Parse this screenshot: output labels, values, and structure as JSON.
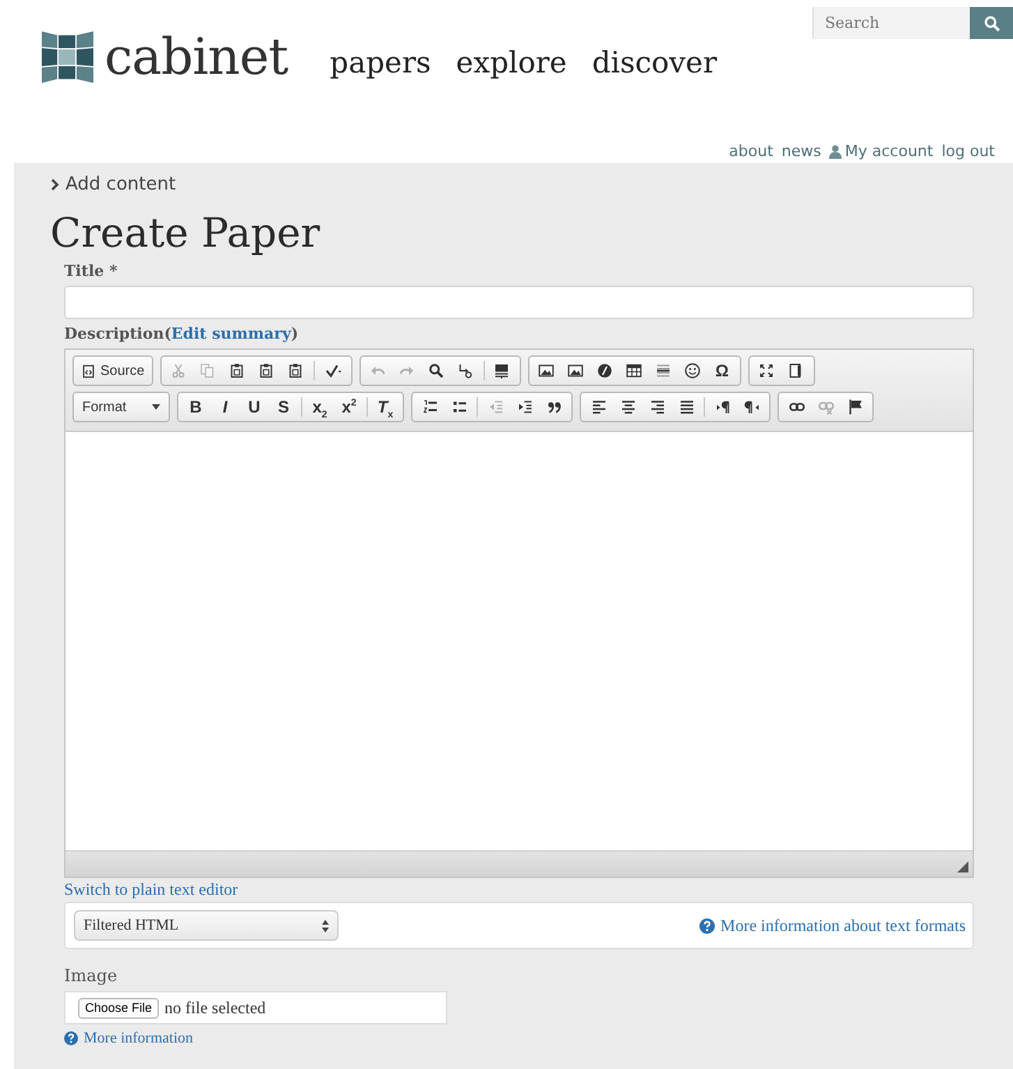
{
  "header": {
    "logo_text": "cabinet",
    "nav": [
      {
        "label": "papers"
      },
      {
        "label": "explore"
      },
      {
        "label": "discover"
      }
    ],
    "search": {
      "placeholder": "Search"
    }
  },
  "user_links": [
    {
      "label": "about",
      "kind": "plain"
    },
    {
      "label": "news",
      "kind": "plain"
    },
    {
      "label": "My account",
      "kind": "account"
    },
    {
      "label": "log out",
      "kind": "plain"
    }
  ],
  "breadcrumb": "Add content",
  "page_title": "Create Paper",
  "title_field": {
    "label": "Title",
    "required_mark": "*"
  },
  "description": {
    "label": "Description(",
    "link": "Edit summary",
    "suffix": ")"
  },
  "toolbar": [
    [
      [
        {
          "kind": "source",
          "label": "Source",
          "disabled": false
        }
      ],
      [
        {
          "kind": "cut",
          "disabled": true
        },
        {
          "kind": "copy",
          "disabled": true
        },
        {
          "kind": "paste",
          "disabled": false
        },
        {
          "kind": "paste",
          "disabled": false
        },
        {
          "kind": "paste",
          "disabled": false
        },
        {
          "kind": "separator"
        },
        {
          "kind": "spellcheck",
          "disabled": false
        }
      ],
      [
        {
          "kind": "undo",
          "disabled": true
        },
        {
          "kind": "redo",
          "disabled": true
        },
        {
          "kind": "find",
          "disabled": false
        },
        {
          "kind": "replace",
          "disabled": false
        },
        {
          "kind": "separator"
        },
        {
          "kind": "selectall",
          "disabled": false
        }
      ],
      [
        {
          "kind": "image",
          "disabled": false
        },
        {
          "kind": "image",
          "disabled": false
        },
        {
          "kind": "flash",
          "disabled": false
        },
        {
          "kind": "table",
          "disabled": false
        },
        {
          "kind": "hr",
          "disabled": false
        },
        {
          "kind": "smiley",
          "disabled": false
        },
        {
          "kind": "text",
          "label": "Ω",
          "disabled": false
        }
      ],
      [
        {
          "kind": "maximize",
          "disabled": false
        },
        {
          "kind": "showblocks",
          "disabled": false
        }
      ]
    ],
    [
      [
        {
          "kind": "combo",
          "label": "Format",
          "disabled": false
        }
      ],
      [
        {
          "kind": "text",
          "label": "B",
          "disabled": false
        },
        {
          "kind": "text",
          "label": "*I*",
          "disabled": false
        },
        {
          "kind": "text",
          "label": "U",
          "disabled": false
        },
        {
          "kind": "text",
          "label": "S",
          "disabled": false
        },
        {
          "kind": "separator"
        },
        {
          "kind": "text",
          "label": "x$_{2}$",
          "disabled": false
        },
        {
          "kind": "text",
          "label": "x$^{2}$",
          "disabled": false
        },
        {
          "kind": "separator"
        },
        {
          "kind": "text",
          "label": "*T*$_{x}$",
          "disabled": false
        }
      ],
      [
        {
          "kind": "numbered",
          "disabled": false
        },
        {
          "kind": "bulleted",
          "disabled": false
        },
        {
          "kind": "separator"
        },
        {
          "kind": "outdent",
          "disabled": true
        },
        {
          "kind": "indent",
          "disabled": false
        },
        {
          "kind": "quote",
          "disabled": false
        }
      ],
      [
        {
          "kind": "alignleft",
          "disabled": false
        },
        {
          "kind": "aligncenter",
          "disabled": false
        },
        {
          "kind": "alignright",
          "disabled": false
        },
        {
          "kind": "justify",
          "disabled": false
        },
        {
          "kind": "separator"
        },
        {
          "kind": "ltr",
          "disabled": false
        },
        {
          "kind": "rtl",
          "disabled": false
        }
      ],
      [
        {
          "kind": "link",
          "disabled": false
        },
        {
          "kind": "unlink",
          "disabled": true
        },
        {
          "kind": "anchor",
          "disabled": false
        }
      ]
    ]
  ],
  "switch_link": "Switch to plain text editor",
  "text_format": {
    "selected": "Filtered HTML",
    "help_link": "More information about text formats"
  },
  "image_field": {
    "label": "Image",
    "button": "Choose File",
    "status": "no file selected",
    "help_link": "More information"
  }
}
